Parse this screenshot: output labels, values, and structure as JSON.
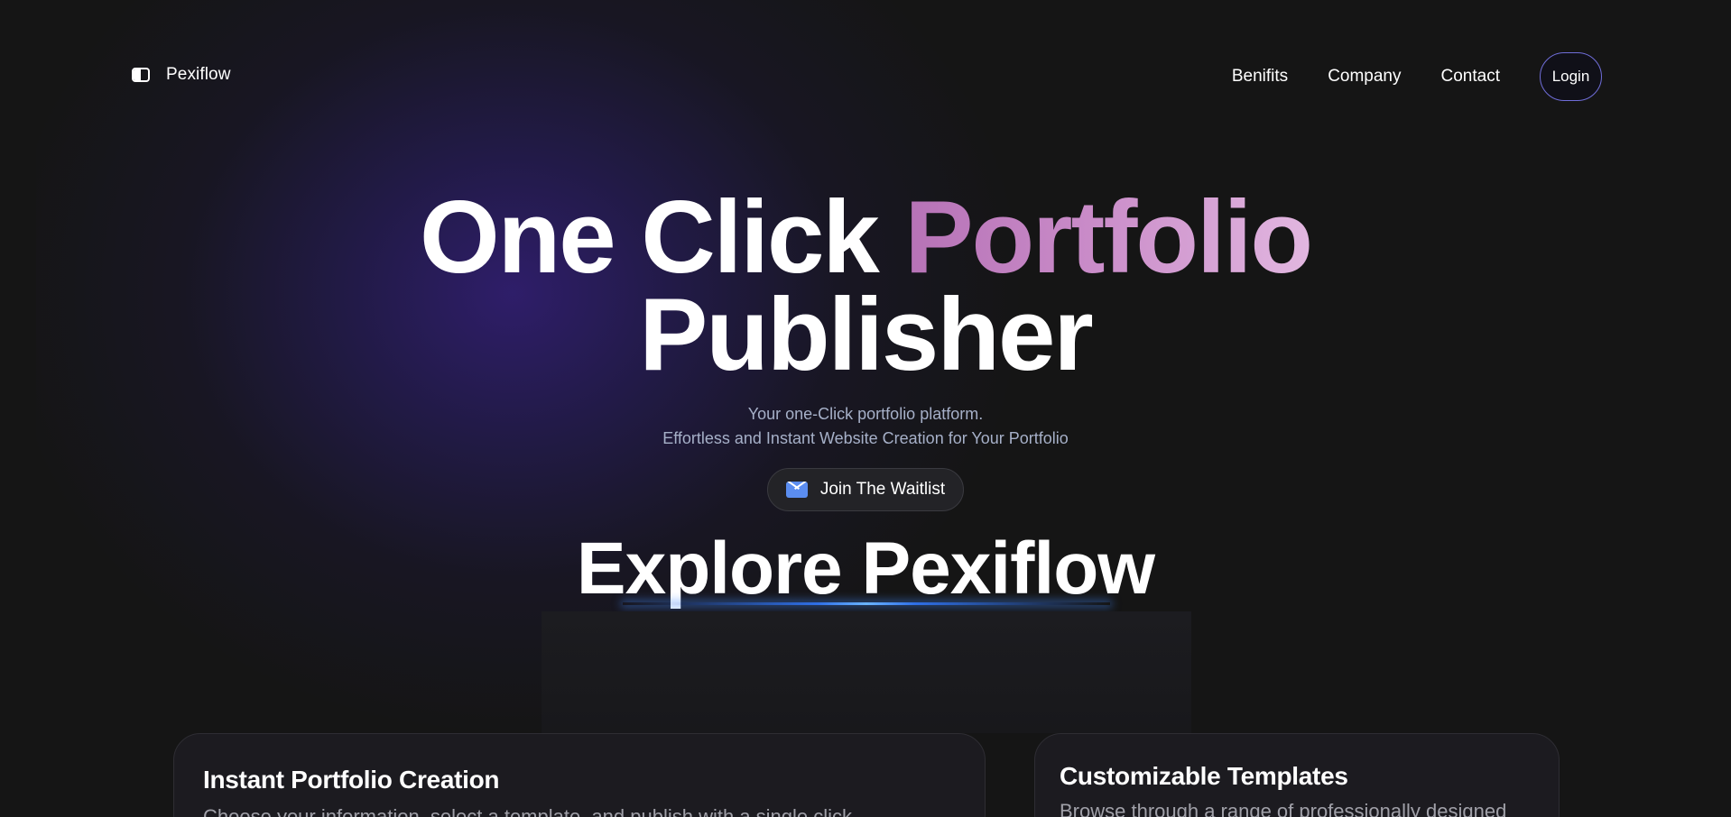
{
  "brand": {
    "name": "Pexiflow",
    "icon": "brand-logo-icon"
  },
  "nav": {
    "links": [
      "Benifits",
      "Company",
      "Contact"
    ],
    "login_label": "Login"
  },
  "hero": {
    "title_part1": "One Click ",
    "title_accent": "Portfolio",
    "title_line2": "Publisher",
    "subtitle_line1": "Your one-Click portfolio platform.",
    "subtitle_line2": "Effortless and Instant Website Creation for Your Portfolio",
    "cta_label": "Join The Waitlist",
    "cta_icon": "mail-icon"
  },
  "explore": {
    "title": "Explore Pexiflow"
  },
  "features": [
    {
      "title": "Instant Portfolio Creation",
      "description": "Choose your information, select a template, and publish with a single click."
    },
    {
      "title": "Customizable Templates",
      "description": "Browse through a range of professionally designed"
    }
  ],
  "colors": {
    "background": "#151515",
    "accent_gradient": [
      "#b672b6",
      "#e2b7e0"
    ],
    "cta_icon": "#5b8df0",
    "login_border": "#6f6dd8"
  }
}
